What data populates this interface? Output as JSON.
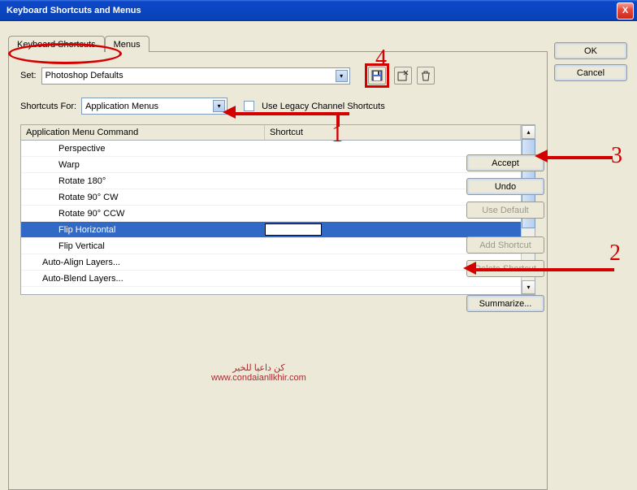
{
  "window": {
    "title": "Keyboard Shortcuts and Menus",
    "close": "X"
  },
  "tabs": {
    "kbd": "Keyboard Shortcuts",
    "menus": "Menus"
  },
  "setRow": {
    "label": "Set:",
    "value": "Photoshop Defaults"
  },
  "shortcutsFor": {
    "label": "Shortcuts For:",
    "value": "Application Menus",
    "legacy": "Use Legacy Channel Shortcuts"
  },
  "grid": {
    "col1": "Application Menu Command",
    "col2": "Shortcut",
    "rows": [
      {
        "cmd": "Perspective",
        "lvl": 1
      },
      {
        "cmd": "Warp",
        "lvl": 1
      },
      {
        "cmd": "Rotate 180°",
        "lvl": 1
      },
      {
        "cmd": "Rotate 90° CW",
        "lvl": 1
      },
      {
        "cmd": "Rotate 90° CCW",
        "lvl": 1
      },
      {
        "cmd": "Flip Horizontal",
        "lvl": 1,
        "sel": true
      },
      {
        "cmd": "Flip Vertical",
        "lvl": 1
      },
      {
        "cmd": "Auto-Align Layers...",
        "lvl": 0
      },
      {
        "cmd": "Auto-Blend Layers...",
        "lvl": 0
      }
    ]
  },
  "sideButtons": {
    "ok": "OK",
    "cancel": "Cancel"
  },
  "actionButtons": {
    "accept": "Accept",
    "undo": "Undo",
    "useDefault": "Use Default",
    "addShortcut": "Add Shortcut",
    "deleteShortcut": "Delete Shortcut",
    "summarize": "Summarize..."
  },
  "annotations": {
    "n1": "1",
    "n2": "2",
    "n3": "3",
    "n4": "4"
  },
  "watermark": {
    "line1": "كن داعيا للخير",
    "line2": "www.condaianllkhir.com"
  }
}
